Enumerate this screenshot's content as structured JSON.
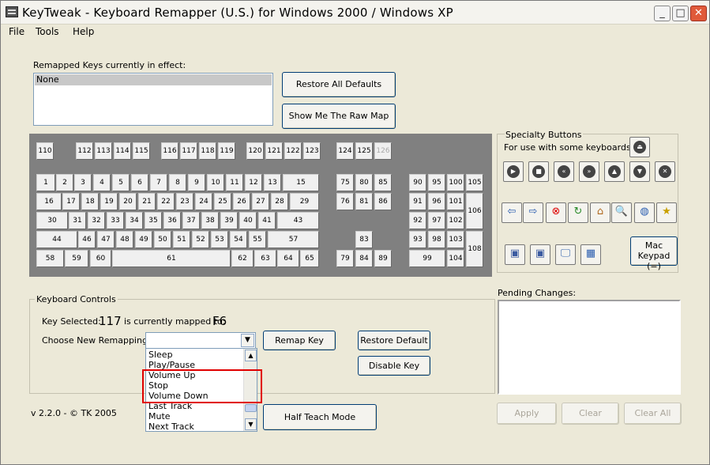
{
  "window": {
    "title": "KeyTweak -  Keyboard Remapper (U.S.)  for Windows 2000 / Windows XP"
  },
  "menu": {
    "file": "File",
    "tools": "Tools",
    "help": "Help"
  },
  "remapped": {
    "label": "Remapped Keys currently in effect:",
    "items": [
      "None"
    ]
  },
  "buttons": {
    "restore_all": "Restore All Defaults",
    "show_raw": "Show Me The Raw Map",
    "remap": "Remap Key",
    "restore_default": "Restore Default",
    "disable": "Disable Key",
    "half_teach": "Half Teach Mode",
    "apply": "Apply",
    "clear": "Clear",
    "clear_all": "Clear All",
    "mac_keypad": "Mac Keypad (=)"
  },
  "keyboard": {
    "fn_row": [
      "110",
      "112",
      "113",
      "114",
      "115",
      "116",
      "117",
      "118",
      "119",
      "120",
      "121",
      "122",
      "123",
      "124",
      "125",
      "126"
    ],
    "row1": [
      "1",
      "2",
      "3",
      "4",
      "5",
      "6",
      "7",
      "8",
      "9",
      "10",
      "11",
      "12",
      "13",
      "15"
    ],
    "row2": [
      "16",
      "17",
      "18",
      "19",
      "20",
      "21",
      "22",
      "23",
      "24",
      "25",
      "26",
      "27",
      "28",
      "29"
    ],
    "row3": [
      "30",
      "31",
      "32",
      "33",
      "34",
      "35",
      "36",
      "37",
      "38",
      "39",
      "40",
      "41",
      "43"
    ],
    "row4": [
      "44",
      "46",
      "47",
      "48",
      "49",
      "50",
      "51",
      "52",
      "53",
      "54",
      "55",
      "57"
    ],
    "row5": [
      "58",
      "59",
      "60",
      "61",
      "62",
      "63",
      "64",
      "65"
    ],
    "nav": [
      "75",
      "80",
      "85",
      "76",
      "81",
      "86",
      "83",
      "79",
      "84",
      "89"
    ],
    "numpad": [
      "90",
      "95",
      "100",
      "105",
      "91",
      "96",
      "101",
      "106",
      "92",
      "97",
      "102",
      "93",
      "98",
      "103",
      "108",
      "99",
      "104"
    ]
  },
  "specialty": {
    "title": "Specialty Buttons",
    "subtitle": "For use with some keyboards"
  },
  "controls": {
    "title": "Keyboard Controls",
    "key_selected_label": "Key Selected:",
    "key_selected_value": "117",
    "mapped_label": "is currently mapped to:",
    "mapped_value": "F6",
    "choose_label": "Choose New Remapping",
    "dropdown_value": ""
  },
  "dropdown_items": [
    "Sleep",
    "Play/Pause",
    "Volume Up",
    "Stop",
    "Volume Down",
    "Last Track",
    "Mute",
    "Next Track"
  ],
  "pending": {
    "label": "Pending Changes:"
  },
  "version": "v 2.2.0 - © TK 2005"
}
